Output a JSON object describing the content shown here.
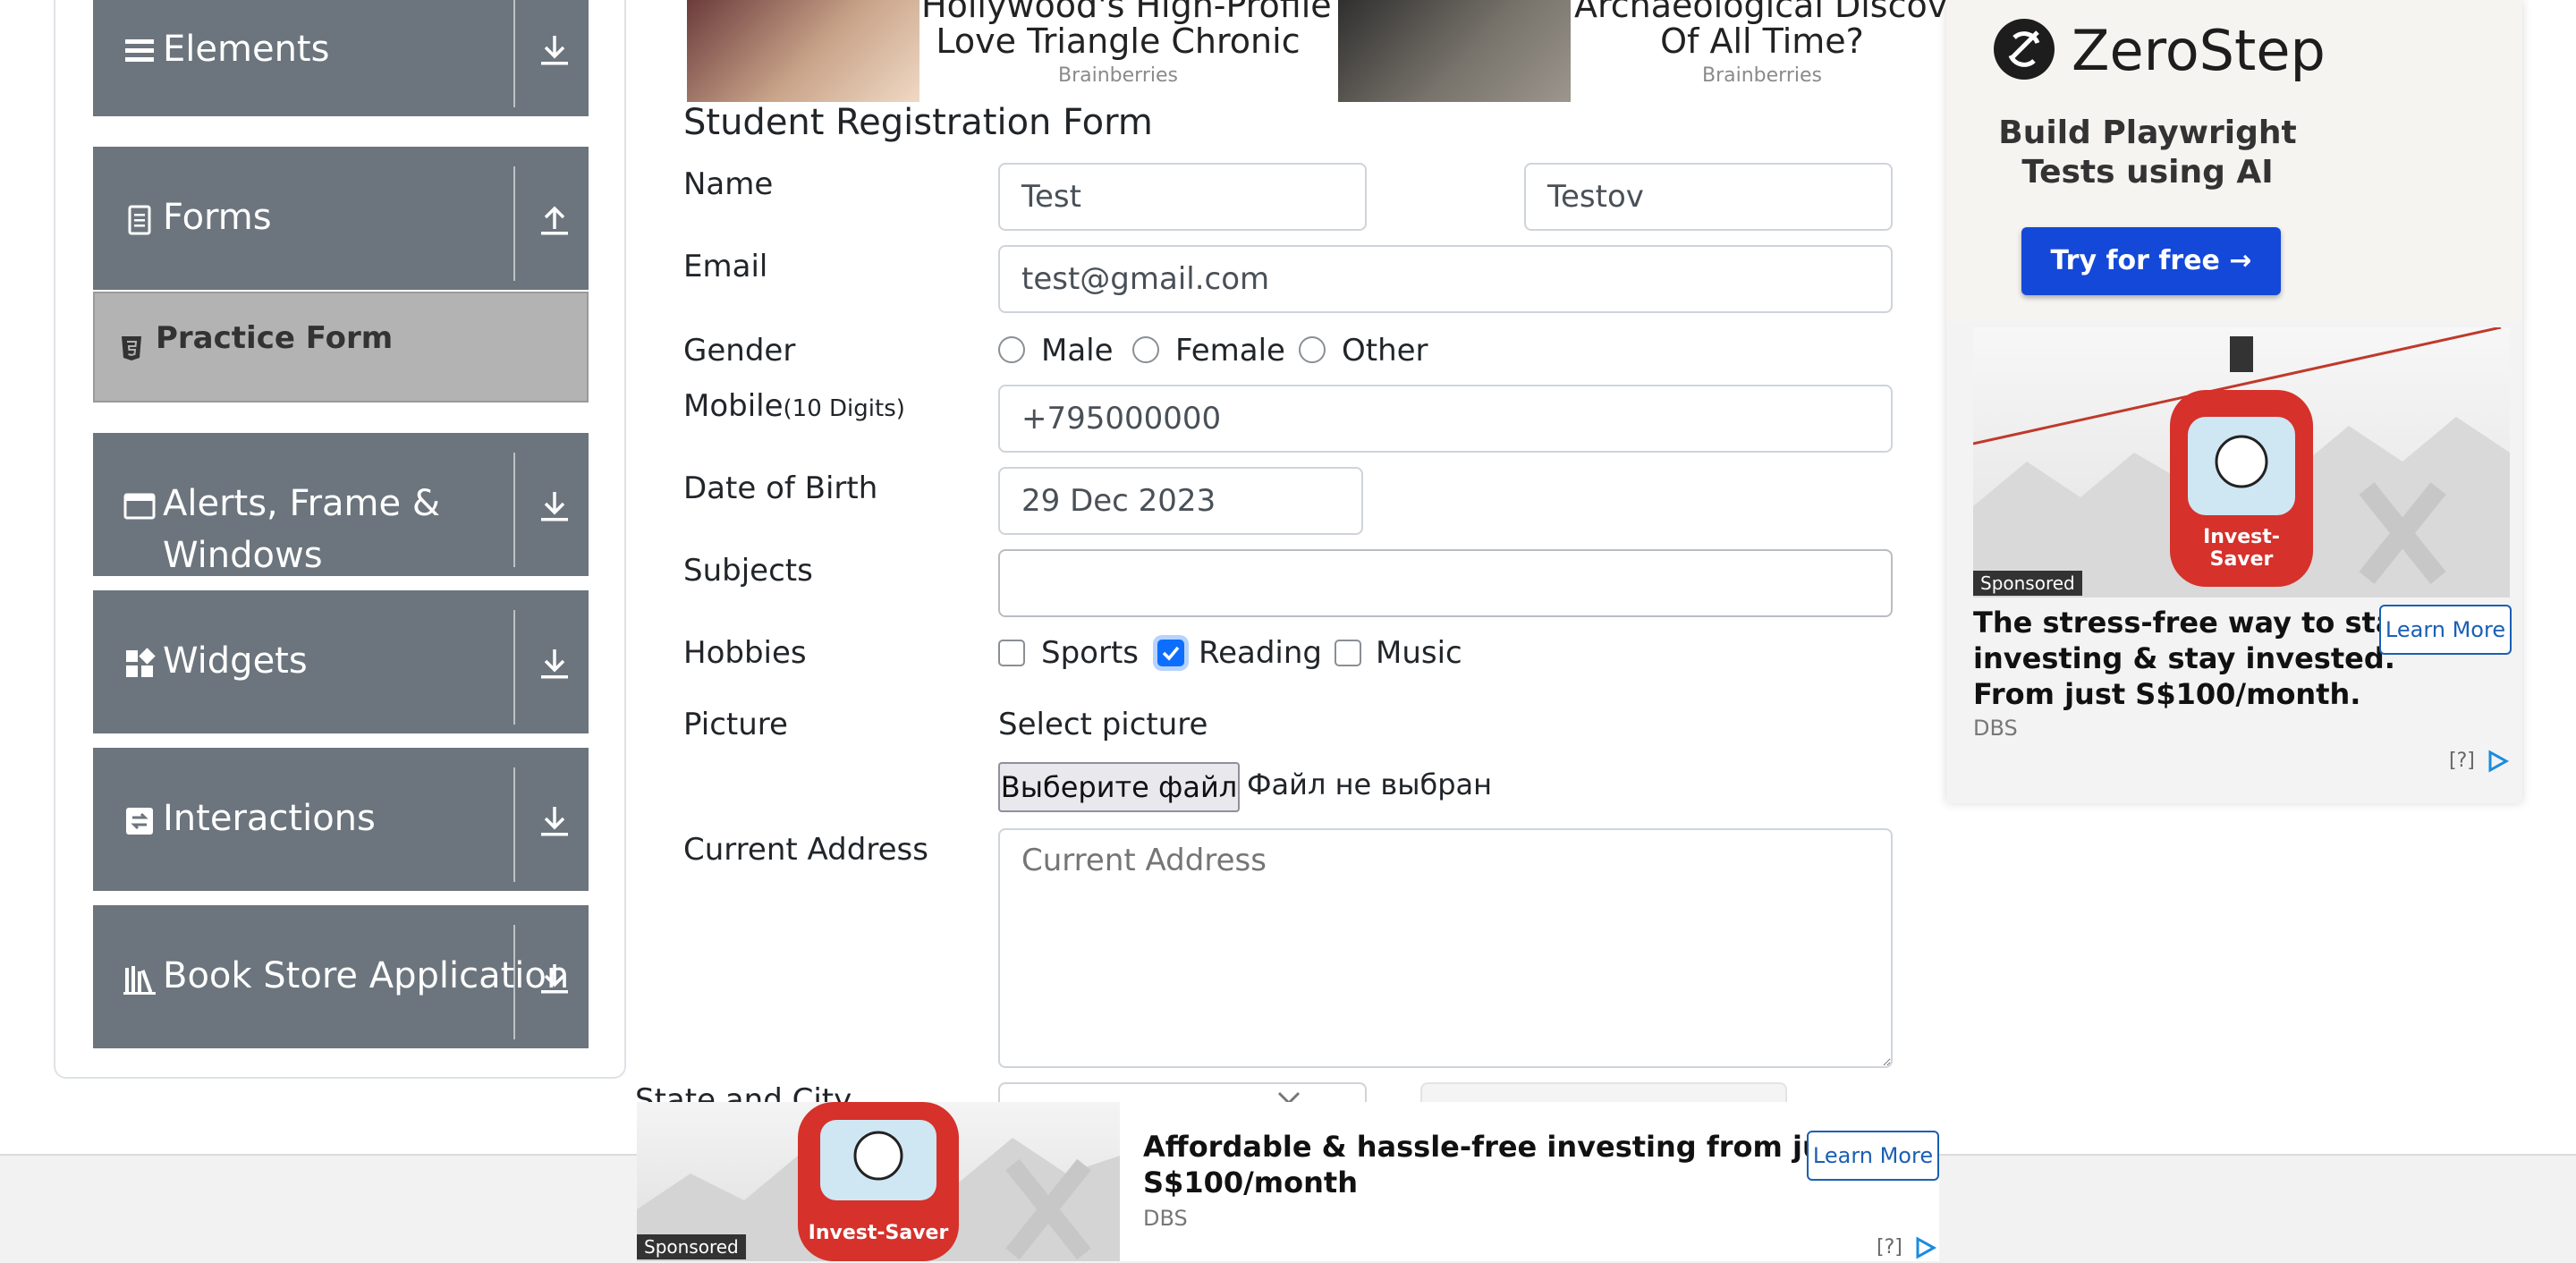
{
  "sidebar": {
    "groups": [
      {
        "label": "Elements",
        "icon": "list-icon",
        "arrow": "download-arrow-icon"
      },
      {
        "label": "Forms",
        "icon": "document-icon",
        "arrow": "upload-arrow-icon"
      },
      {
        "label": "Alerts, Frame &",
        "label2": "Windows",
        "icon": "window-icon",
        "arrow": "download-arrow-icon"
      },
      {
        "label": "Widgets",
        "icon": "widgets-icon",
        "arrow": "download-arrow-icon"
      },
      {
        "label": "Interactions",
        "icon": "interactions-icon",
        "arrow": "download-arrow-icon"
      },
      {
        "label": "Book Store Application",
        "icon": "books-icon",
        "arrow": "download-arrow-icon"
      }
    ],
    "active_item": "Practice Form"
  },
  "top_ads": [
    {
      "title_line1": "Hollywood's High-Profile",
      "title_line2": "Love Triangle Chronic",
      "source": "Brainberries"
    },
    {
      "title_line1": "Archaeological Discovery",
      "title_line2": "Of All Time?",
      "source": "Brainberries"
    }
  ],
  "form": {
    "title": "Student Registration Form",
    "name_label": "Name",
    "first_name": "Test",
    "last_name": "Testov",
    "email_label": "Email",
    "email": "test@gmail.com",
    "gender_label": "Gender",
    "genders": [
      "Male",
      "Female",
      "Other"
    ],
    "mobile_label": "Mobile",
    "mobile_hint": "(10 Digits)",
    "mobile": "+795000000",
    "dob_label": "Date of Birth",
    "dob": "29 Dec 2023",
    "subjects_label": "Subjects",
    "subjects": "",
    "hobbies_label": "Hobbies",
    "hobbies": [
      {
        "label": "Sports",
        "checked": false
      },
      {
        "label": "Reading",
        "checked": true
      },
      {
        "label": "Music",
        "checked": false
      }
    ],
    "picture_label": "Picture",
    "select_picture": "Select picture",
    "file_button": "Выберите файл",
    "file_status": "Файл не выбран",
    "address_label": "Current Address",
    "address_placeholder": "Current Address",
    "state_city_label": "State and City"
  },
  "right_ad": {
    "brand": "ZeroStep",
    "headline_line1": "Build Playwright",
    "headline_line2": "Tests using AI",
    "cta": "Try for free →",
    "image_badge": "Invest-Saver",
    "sponsored": "Sponsored",
    "text_line1": "The stress-free way to start",
    "text_line2": "investing & stay invested.",
    "text_line3": "From just S$100/month.",
    "learn_more": "Learn More",
    "advertiser": "DBS",
    "help": "[?]"
  },
  "bottom_ad": {
    "image_badge": "Invest-Saver",
    "sponsored": "Sponsored",
    "text_line1": "Affordable & hassle-free investing from just",
    "text_line2": "S$100/month",
    "advertiser": "DBS",
    "learn_more": "Learn More",
    "help": "[?]"
  },
  "colors": {
    "sidebar_group": "#6c757d",
    "accent": "#0d6efd",
    "active_item": "#b3b3b3"
  }
}
